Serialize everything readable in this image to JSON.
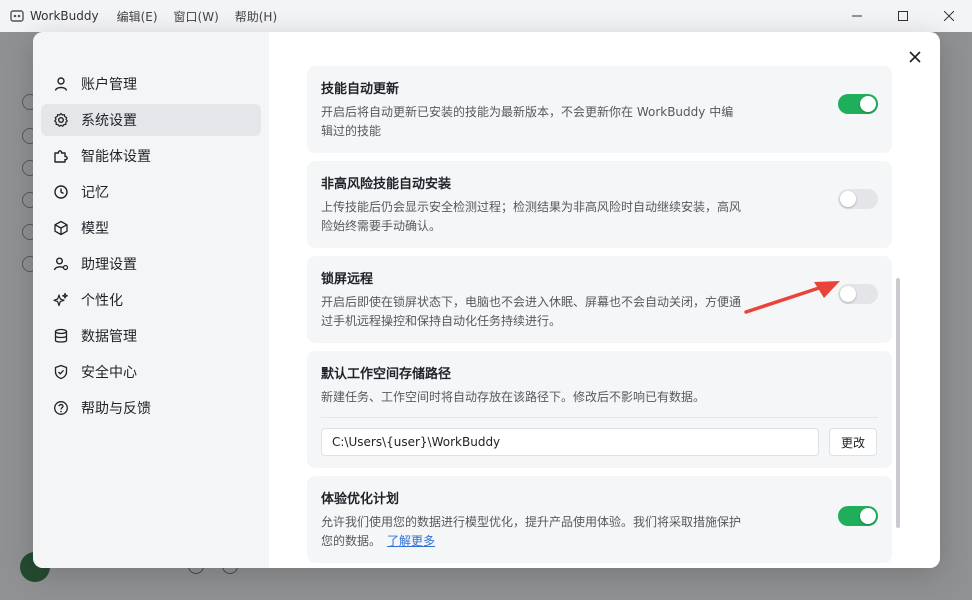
{
  "window": {
    "title": "WorkBuddy",
    "menus": [
      "编辑(E)",
      "窗口(W)",
      "帮助(H)"
    ],
    "minimize_icon": "minimize-icon",
    "maximize_icon": "maximize-icon",
    "close_icon": "close-icon"
  },
  "sidebar": {
    "items": [
      {
        "label": "账户管理",
        "icon": "user-icon"
      },
      {
        "label": "系统设置",
        "icon": "gear-icon",
        "active": true
      },
      {
        "label": "智能体设置",
        "icon": "puzzle-icon"
      },
      {
        "label": "记忆",
        "icon": "memory-icon"
      },
      {
        "label": "模型",
        "icon": "cube-icon"
      },
      {
        "label": "助理设置",
        "icon": "assistant-icon"
      },
      {
        "label": "个性化",
        "icon": "sparkle-icon"
      },
      {
        "label": "数据管理",
        "icon": "database-icon"
      },
      {
        "label": "安全中心",
        "icon": "shield-icon"
      },
      {
        "label": "帮助与反馈",
        "icon": "help-icon"
      }
    ]
  },
  "settings": {
    "skill_auto_update": {
      "title": "技能自动更新",
      "desc": "开启后将自动更新已安装的技能为最新版本，不会更新你在 WorkBuddy 中编辑过的技能",
      "enabled": true
    },
    "low_risk_auto_install": {
      "title": "非高风险技能自动安装",
      "desc": "上传技能后仍会显示安全检测过程；检测结果为非高风险时自动继续安装，高风险始终需要手动确认。",
      "enabled": false
    },
    "lock_screen_remote": {
      "title": "锁屏远程",
      "desc": "开启后即使在锁屏状态下，电脑也不会进入休眠、屏幕也不会自动关闭，方便通过手机远程操控和保持自动化任务持续进行。",
      "enabled": false
    },
    "workspace_path": {
      "title": "默认工作空间存储路径",
      "desc": "新建任务、工作空间时将自动存放在该路径下。修改后不影响已有数据。",
      "value": "C:\\Users\\{user}\\WorkBuddy",
      "change_label": "更改"
    },
    "experience_program": {
      "title": "体验优化计划",
      "desc": "允许我们使用您的数据进行模型优化，提升产品使用体验。我们将采取措施保护您的数据。",
      "link": "了解更多",
      "enabled": true
    }
  },
  "colors": {
    "toggle_on": "#1fae5a",
    "toggle_off": "#e3e5e8",
    "annotation_arrow": "#e8443a",
    "link": "#2f6fd6"
  }
}
